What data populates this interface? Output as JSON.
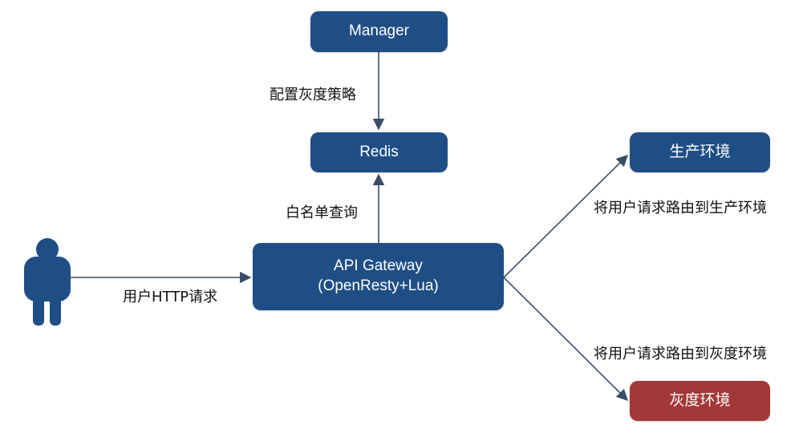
{
  "colors": {
    "node_blue": "#1f4e85",
    "node_red": "#a33838",
    "arrow": "#3a4d66",
    "user": "#1f4e85"
  },
  "nodes": {
    "manager": "Manager",
    "redis": "Redis",
    "gateway": "API Gateway",
    "gateway_sub": "(OpenResty+Lua)",
    "production": "生产环境",
    "gray": "灰度环境"
  },
  "edges": {
    "manager_to_redis": "配置灰度策略",
    "gateway_to_redis": "白名单查询",
    "user_to_gateway": "用户HTTP请求",
    "gateway_to_production": "将用户请求路由到生产环境",
    "gateway_to_gray": "将用户请求路由到灰度环境"
  },
  "icons": {
    "user": "user-icon"
  }
}
